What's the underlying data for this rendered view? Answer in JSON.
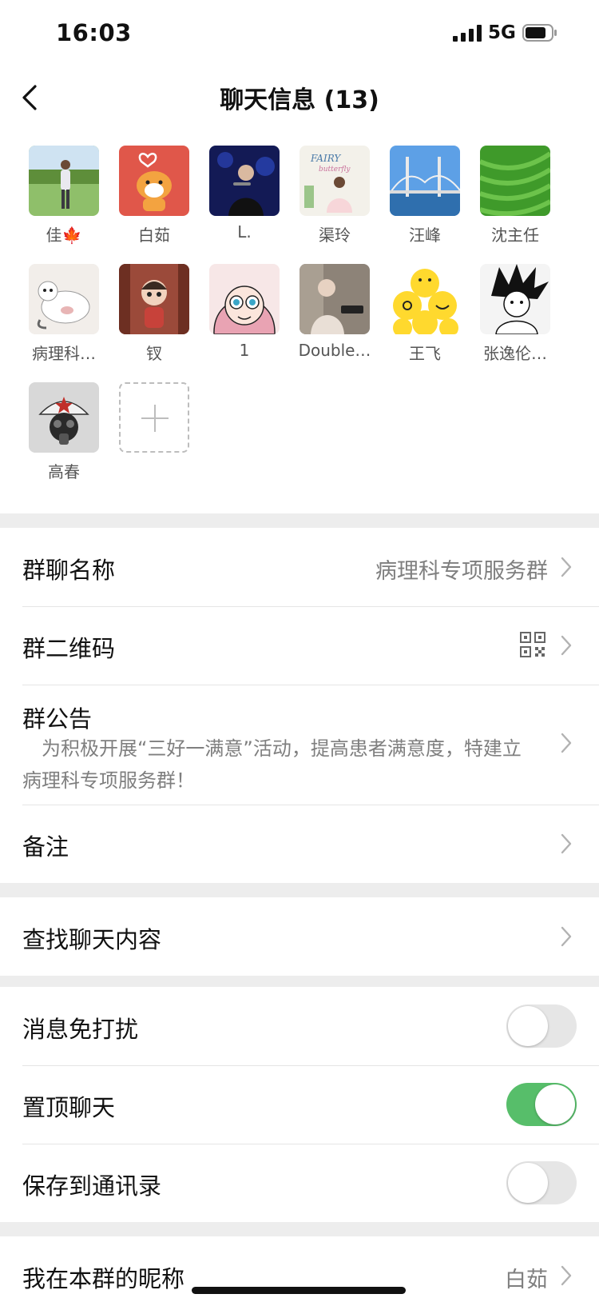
{
  "status_bar": {
    "time": "16:03",
    "network": "5G"
  },
  "nav": {
    "title": "聊天信息 (13)"
  },
  "members": [
    {
      "name": "佳🍁"
    },
    {
      "name": "白茹"
    },
    {
      "name": "L."
    },
    {
      "name": "渠玲"
    },
    {
      "name": "汪峰"
    },
    {
      "name": "沈主任"
    },
    {
      "name": "病理科…"
    },
    {
      "name": "钗"
    },
    {
      "name": "1"
    },
    {
      "name": "Double…"
    },
    {
      "name": "王飞"
    },
    {
      "name": "张逸伦…"
    },
    {
      "name": "高春"
    }
  ],
  "settings": {
    "group_name": {
      "label": "群聊名称",
      "value": "病理科专项服务群"
    },
    "qr_code": {
      "label": "群二维码"
    },
    "notice": {
      "label": "群公告",
      "text": "为积极开展“三好一满意”活动，提高患者满意度，特建立病理科专项服务群！"
    },
    "remark": {
      "label": "备注"
    },
    "search": {
      "label": "查找聊天内容"
    },
    "mute": {
      "label": "消息免打扰",
      "on": false
    },
    "pin": {
      "label": "置顶聊天",
      "on": true
    },
    "save_contacts": {
      "label": "保存到通讯录",
      "on": false
    },
    "my_nickname": {
      "label": "我在本群的昵称",
      "value": "白茹"
    }
  },
  "colors": {
    "toggle_on": "#57be6a",
    "background": "#ededed"
  }
}
